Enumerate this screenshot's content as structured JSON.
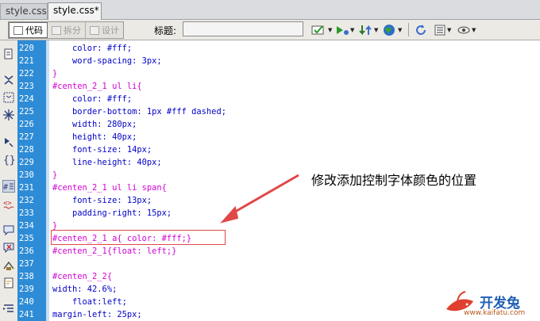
{
  "tabs": [
    {
      "label": "style.css",
      "active": false
    },
    {
      "label": "style.css*",
      "active": true
    }
  ],
  "toolbar": {
    "code_label": "代码",
    "split_label": "拆分",
    "design_label": "设计",
    "title_label": "标题:",
    "title_value": ""
  },
  "code_lines": [
    {
      "n": "220",
      "text": "    color: #fff;",
      "kind": "prop"
    },
    {
      "n": "221",
      "text": "    word-spacing: 3px;",
      "kind": "prop"
    },
    {
      "n": "222",
      "text": "}",
      "kind": "sel"
    },
    {
      "n": "223",
      "text": "#centen_2_1 ul li{",
      "kind": "sel"
    },
    {
      "n": "224",
      "text": "    color: #fff;",
      "kind": "prop"
    },
    {
      "n": "225",
      "text": "    border-bottom: 1px #fff dashed;",
      "kind": "prop"
    },
    {
      "n": "226",
      "text": "    width: 280px;",
      "kind": "prop"
    },
    {
      "n": "227",
      "text": "    height: 40px;",
      "kind": "prop"
    },
    {
      "n": "228",
      "text": "    font-size: 14px;",
      "kind": "prop"
    },
    {
      "n": "229",
      "text": "    line-height: 40px;",
      "kind": "prop"
    },
    {
      "n": "230",
      "text": "}",
      "kind": "sel"
    },
    {
      "n": "231",
      "text": "#centen_2_1 ul li span{",
      "kind": "sel"
    },
    {
      "n": "232",
      "text": "    font-size: 13px;",
      "kind": "prop"
    },
    {
      "n": "233",
      "text": "    padding-right: 15px;",
      "kind": "prop"
    },
    {
      "n": "234",
      "text": "}",
      "kind": "sel"
    },
    {
      "n": "235",
      "text": "#centen_2_1 a{ color: #fff;}",
      "kind": "sel"
    },
    {
      "n": "236",
      "text": "#centen_2_1{float: left;}",
      "kind": "sel"
    },
    {
      "n": "237",
      "text": "",
      "kind": "sel"
    },
    {
      "n": "238",
      "text": "#centen_2_2{",
      "kind": "sel"
    },
    {
      "n": "239",
      "text": "width: 42.6%;",
      "kind": "prop"
    },
    {
      "n": "240",
      "text": "    float:left;",
      "kind": "prop"
    },
    {
      "n": "241",
      "text": "margin-left: 25px;",
      "kind": "prop"
    }
  ],
  "annotation": {
    "text": "修改添加控制字体颜色的位置",
    "color": "#e04848"
  },
  "watermark": {
    "title": "开发兔",
    "url": "www.kaifatu.com"
  },
  "colors": {
    "gutter": "#2e8cd6",
    "selector": "#d200d2",
    "property": "#0000c8"
  },
  "icons": {
    "toolbar": [
      "validate-icon",
      "preview-browser-icon",
      "file-transfer-icon",
      "globe-icon",
      "refresh-icon",
      "view-options-icon",
      "visual-aids-icon"
    ],
    "sidebar": [
      "open-documents-icon",
      "collapse-full-tag-icon",
      "collapse-selection-icon",
      "expand-all-icon",
      "select-parent-tag-icon",
      "balance-braces-icon",
      "line-numbers-icon",
      "highlight-invalid-code-icon",
      "apply-comment-icon",
      "remove-comment-icon",
      "wrap-tag-icon",
      "recent-snippets-icon",
      "indent-code-icon"
    ]
  }
}
